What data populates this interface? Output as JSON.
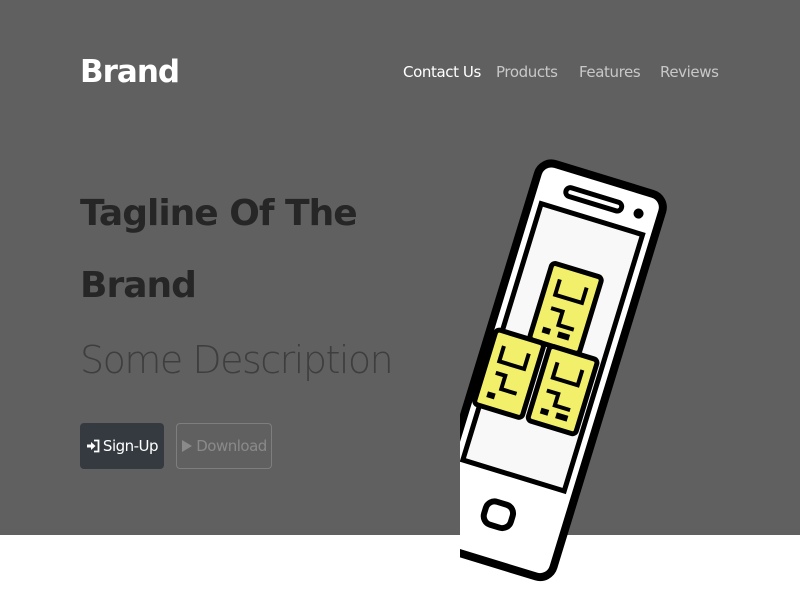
{
  "header": {
    "brand": "Brand",
    "nav": [
      {
        "label": "Contact Us",
        "active": true
      },
      {
        "label": "Products",
        "active": false
      },
      {
        "label": "Features",
        "active": false
      },
      {
        "label": "Reviews",
        "active": false
      }
    ]
  },
  "hero": {
    "tagline": "Tagline Of The Brand",
    "description": "Some Description",
    "signup_label": "Sign-Up",
    "download_label": "Download",
    "signup_icon": "sign-in-icon",
    "download_icon": "play-store-icon",
    "illustration": "phone-with-qr-blocks-icon"
  },
  "colors": {
    "hero_background": "#606060",
    "page_background": "#ffffff",
    "button_dark": "#343a40",
    "accent_yellow": "#f2ef6a"
  }
}
